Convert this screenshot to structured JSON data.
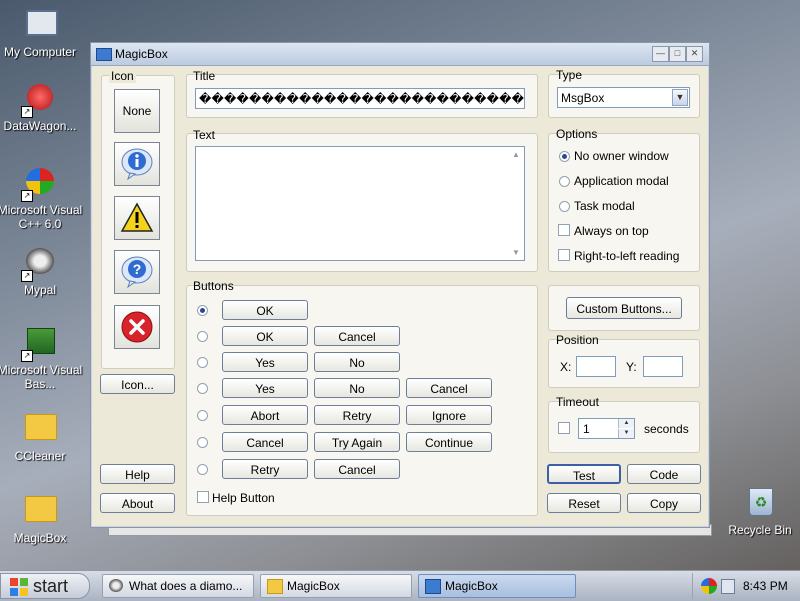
{
  "desktop": {
    "icons": [
      {
        "label": "My Computer"
      },
      {
        "label": "DataWagon..."
      },
      {
        "label": "Microsoft Visual C++ 6.0"
      },
      {
        "label": "Mypal"
      },
      {
        "label": "Microsoft Visual Bas..."
      },
      {
        "label": "CCleaner"
      },
      {
        "label": "MagicBox"
      },
      {
        "label": "Recycle Bin"
      }
    ]
  },
  "window": {
    "title": "MagicBox",
    "icon_group": {
      "label": "Icon",
      "none_label": "None",
      "icon_button_label": "Icon...",
      "icons": [
        "information-icon",
        "warning-icon",
        "question-icon",
        "error-icon"
      ]
    },
    "title_group": {
      "label": "Title",
      "value": "������������������������������"
    },
    "text_group": {
      "label": "Text",
      "value": ""
    },
    "type_group": {
      "label": "Type",
      "selected": "MsgBox"
    },
    "options_group": {
      "label": "Options",
      "radios": [
        {
          "label": "No owner window",
          "checked": true
        },
        {
          "label": "Application modal",
          "checked": false
        },
        {
          "label": "Task modal",
          "checked": false
        }
      ],
      "checks": [
        {
          "label": "Always on top",
          "checked": false
        },
        {
          "label": "Right-to-left reading",
          "checked": false
        }
      ]
    },
    "buttons_group": {
      "label": "Buttons",
      "rows": [
        [
          "OK"
        ],
        [
          "OK",
          "Cancel"
        ],
        [
          "Yes",
          "No"
        ],
        [
          "Yes",
          "No",
          "Cancel"
        ],
        [
          "Abort",
          "Retry",
          "Ignore"
        ],
        [
          "Cancel",
          "Try Again",
          "Continue"
        ],
        [
          "Retry",
          "Cancel"
        ]
      ],
      "help_button_label": "Help Button"
    },
    "custom_buttons_label": "Custom Buttons...",
    "position_group": {
      "label": "Position",
      "x_label": "X:",
      "y_label": "Y:",
      "x_value": "",
      "y_value": ""
    },
    "timeout_group": {
      "label": "Timeout",
      "value": "1",
      "unit": "seconds"
    },
    "actions": {
      "help": "Help",
      "about": "About",
      "test": "Test",
      "code": "Code",
      "reset": "Reset",
      "copy": "Copy"
    }
  },
  "taskbar": {
    "start_label": "start",
    "tasks": [
      {
        "label": "What does a diamo..."
      },
      {
        "label": "MagicBox"
      },
      {
        "label": "MagicBox"
      }
    ],
    "clock": "8:43 PM"
  },
  "colors": {
    "window_bg": "#ece9d8",
    "accent": "#2b4a8c",
    "warning": "#f4d41a",
    "error": "#d8232a",
    "info": "#2f6bd0"
  }
}
